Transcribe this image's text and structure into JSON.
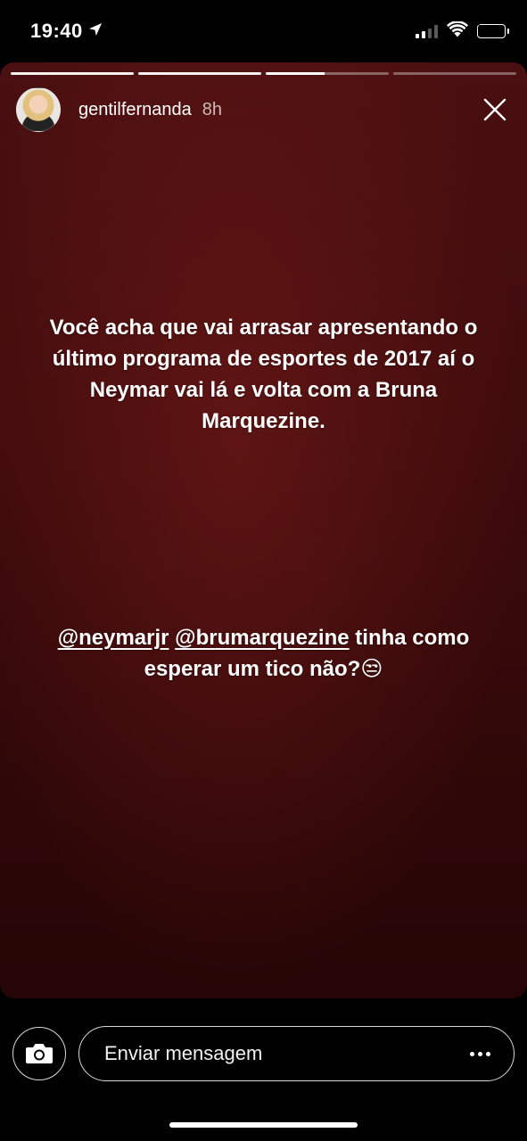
{
  "status_bar": {
    "time": "19:40",
    "location_icon": "location-arrow-icon",
    "signal_icon": "cellular-signal-icon",
    "wifi_icon": "wifi-icon",
    "battery_icon": "battery-charging-icon",
    "battery_color": "#34c759"
  },
  "story": {
    "segments_total": 4,
    "segments_completed": 2,
    "current_segment_progress": 0.48,
    "username": "gentilfernanda",
    "time_ago": "8h",
    "avatar_icon": "avatar-photo",
    "close_icon": "close-icon",
    "caption_lines": [
      "Você acha que vai arrasar apresentando o",
      "último programa de esportes de 2017 aí o",
      "Neymar vai lá e volta com a Bruna",
      "Marquezine."
    ],
    "mention_1": "@neymarjr",
    "mention_2": "@brumarquezine",
    "mention_suffix": " tinha como",
    "mention_line2": "esperar um tico não?",
    "emoji": "😒"
  },
  "bottom_bar": {
    "camera_icon": "camera-icon",
    "message_placeholder": "Enviar mensagem",
    "more_icon": "more-dots-icon"
  }
}
